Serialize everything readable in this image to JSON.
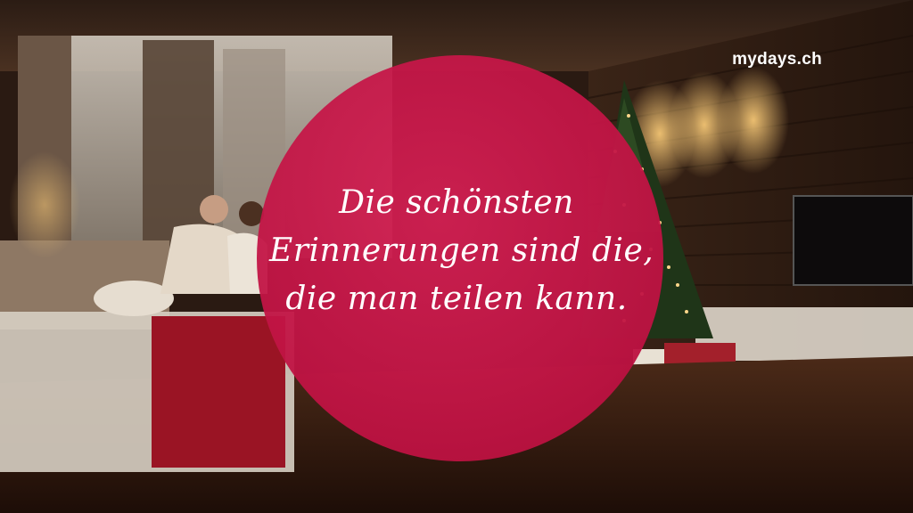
{
  "brand": {
    "label": "mydays.ch"
  },
  "quote": {
    "line1": "Die schönsten",
    "line2": "Erinnerungen sind die,",
    "line3": "die man teilen kann."
  },
  "colors": {
    "circle": "#c8154a",
    "text": "#ffffff"
  },
  "scene": {
    "icons": [
      "christmas-tree-icon",
      "sofa-icon",
      "tv-icon",
      "gift-icon",
      "wall-lamp-icon"
    ]
  }
}
